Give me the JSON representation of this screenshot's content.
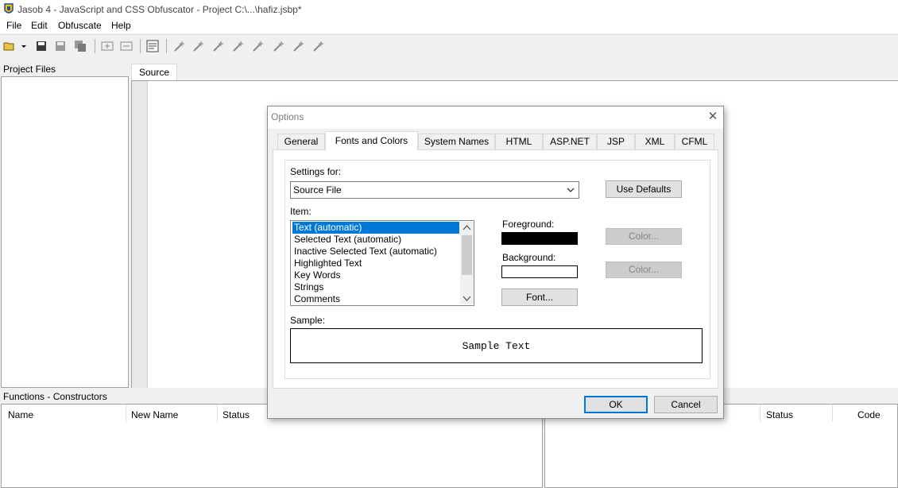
{
  "window": {
    "title": "Jasob 4 - JavaScript and CSS Obfuscator - Project  C:\\...\\hafiz.jsbp*"
  },
  "menu": [
    "File",
    "Edit",
    "Obfuscate",
    "Help"
  ],
  "panels": {
    "project_files": "Project Files",
    "source_tab": "Source",
    "functions_label": "Functions - Constructors",
    "left_columns": [
      "Name",
      "New Name",
      "Status"
    ],
    "right_columns": [
      "Status",
      "Code"
    ]
  },
  "dialog": {
    "title": "Options",
    "tabs": [
      "General",
      "Fonts and Colors",
      "System Names",
      "HTML",
      "ASP.NET",
      "JSP",
      "XML",
      "CFML"
    ],
    "active_tab": "Fonts and Colors",
    "settings_for_label": "Settings for:",
    "settings_for_value": "Source File",
    "use_defaults": "Use Defaults",
    "item_label": "Item:",
    "items": [
      "Text  (automatic)",
      "Selected Text  (automatic)",
      "Inactive Selected Text  (automatic)",
      "Highlighted Text",
      "Key Words",
      "Strings",
      "Comments"
    ],
    "selected_item": 0,
    "foreground_label": "Foreground:",
    "background_label": "Background:",
    "foreground_color": "#000000",
    "background_color": "#ffffff",
    "color_button": "Color...",
    "font_button": "Font...",
    "sample_label": "Sample:",
    "sample_text": "Sample Text",
    "ok": "OK",
    "cancel": "Cancel"
  },
  "colors": {
    "accent": "#0078d7"
  }
}
